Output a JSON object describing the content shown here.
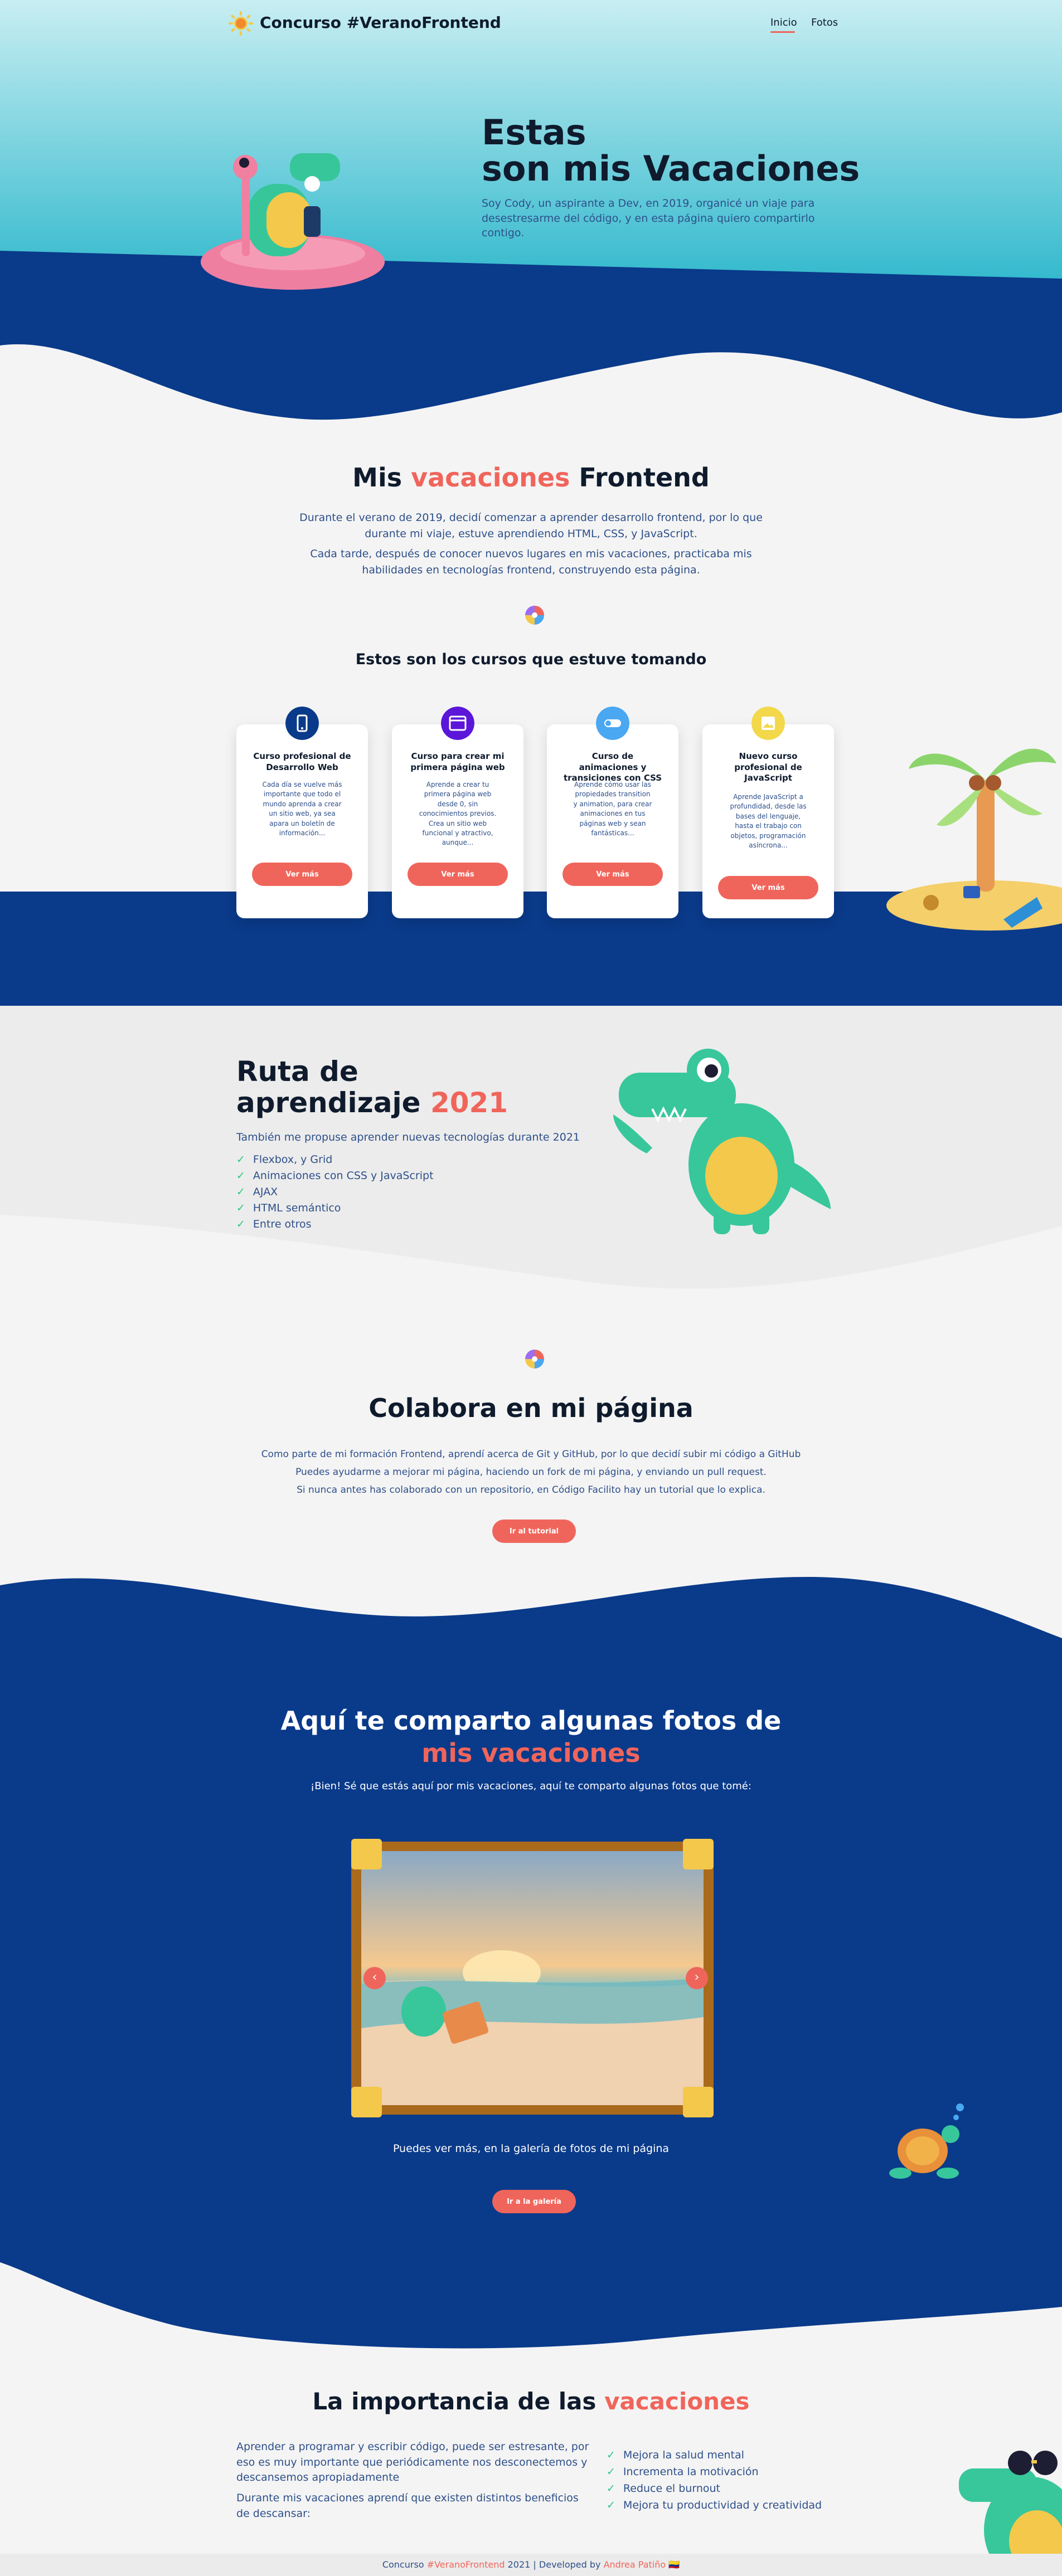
{
  "colors": {
    "navy": "#0a3a8a",
    "coral": "#f0655b",
    "sky_top": "#c8eef2",
    "sky_bottom": "#2fb8cc",
    "background": "#f4f4f4",
    "check": "#2cc58b"
  },
  "nav": {
    "brand": "Concurso #VeranoFrontend",
    "links": [
      "Inicio",
      "Fotos"
    ],
    "active": "Inicio"
  },
  "hero": {
    "title_line1": "Estas",
    "title_line2": "son mis Vacaciones",
    "description": "Soy Cody, un aspirante a Dev, en 2019, organicé un viaje para desestresarme del código, y en esta página quiero compartirlo contigo."
  },
  "mis_vacaciones": {
    "title_pre": "Mis ",
    "title_highlight": "vacaciones",
    "title_post": " Frontend",
    "p1": "Durante el verano de 2019, decidí comenzar a aprender desarrollo frontend, por lo que durante mi viaje, estuve aprendiendo HTML, CSS, y JavaScript.",
    "p2": "Cada tarde, después de conocer nuevos lugares en mis vacaciones, practicaba mis habilidades en tecnologías frontend, construyendo esta página."
  },
  "courses": {
    "title": "Estos son los cursos que estuve tomando",
    "items": [
      {
        "icon": "mobile-icon",
        "color": "#0a3a8a",
        "title": "Curso profesional de Desarrollo Web",
        "description": "Cada día se vuelve más importante que todo el mundo aprenda a crear un sitio web, ya sea apara un boletín de información...",
        "button": "Ver más"
      },
      {
        "icon": "browser-icon",
        "color": "#5b16d9",
        "title": "Curso para crear mi primera página web",
        "description": "Aprende a crear tu primera página web desde 0, sin conocimientos previos. Crea un sitio web funcional y atractivo, aunque...",
        "button": "Ver más"
      },
      {
        "icon": "toggle-icon",
        "color": "#4aa7f2",
        "title": "Curso de animaciones y transiciones con CSS",
        "description": "Aprende cómo usar las propiedades transition y animation, para crear animaciones en tus páginas web y sean fantásticas...",
        "button": "Ver más"
      },
      {
        "icon": "image-icon",
        "color": "#f2d84a",
        "title": "Nuevo curso profesional de JavaScript",
        "description": "Aprende JavaScript a profundidad, desde las bases del lenguaje, hasta el trabajo con objetos, programación asíncrona...",
        "button": "Ver más"
      }
    ]
  },
  "ruta": {
    "title_line1": "Ruta de",
    "title_line2_pre": "aprendizaje ",
    "title_year": "2021",
    "intro": "También me propuse aprender nuevas tecnologías durante 2021",
    "items": [
      "Flexbox, y Grid",
      "Animaciones con CSS y JavaScript",
      "AJAX",
      "HTML semántico",
      "Entre otros"
    ]
  },
  "colabora": {
    "title": "Colabora en mi página",
    "lines": [
      "Como parte de mi formación Frontend, aprendí acerca de Git y GitHub, por lo que decidí subir mi código a GitHub",
      "Puedes ayudarme a mejorar mi página, haciendo un fork de mi página, y enviando un pull request.",
      "Si nunca antes has colaborado con un repositorio, en Código Facilito hay un tutorial que lo explica."
    ],
    "button": "Ir al tutorial"
  },
  "fotos": {
    "title_line1": "Aquí te comparto algunas fotos de",
    "title_line2": "mis vacaciones",
    "subtitle": "¡Bien! Sé que estás aquí por mis vacaciones, aquí te comparto algunas fotos que tomé:",
    "more": "Puedes ver más, en la galería de fotos de mi página",
    "button": "Ir a la galería"
  },
  "importancia": {
    "title_pre": "La importancia de las ",
    "title_highlight": "vacaciones",
    "p1": "Aprender a programar y escribir código, puede ser estresante, por eso es muy importante que periódicamente nos desconectemos y descansemos apropiadamente",
    "p2": "Durante mis vacaciones aprendí que existen distintos beneficios de descansar:",
    "items": [
      "Mejora la salud mental",
      "Incrementa la motivación",
      "Reduce el burnout",
      "Mejora tu productividad y creatividad"
    ]
  },
  "footer": {
    "pre": "Concurso ",
    "tag": "#VeranoFrontend",
    "mid": " 2021 | Developed by ",
    "author": "Andrea Patiño",
    "flag": "🇨🇴"
  }
}
